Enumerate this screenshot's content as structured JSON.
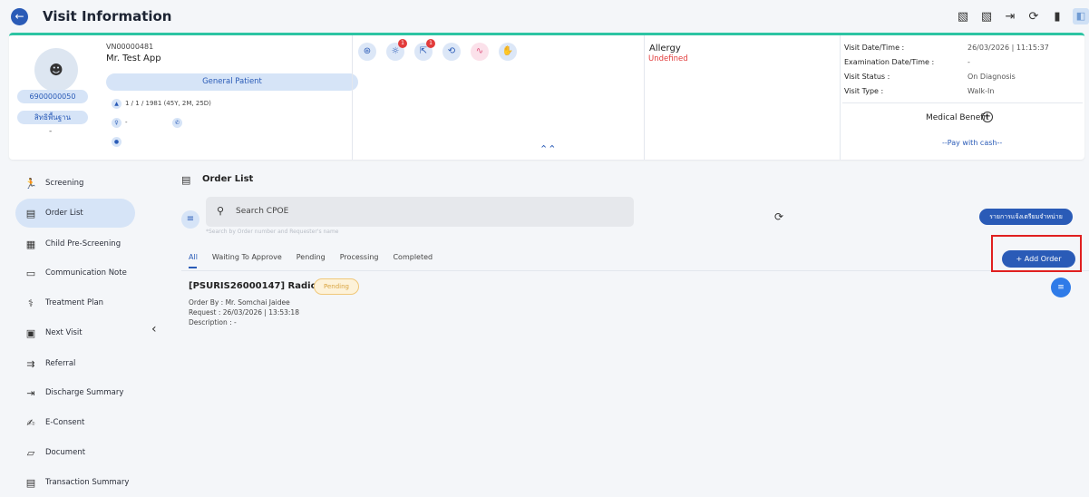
{
  "header": {
    "title": "Visit Information",
    "back_icon": "arrow-left-icon",
    "actions": [
      "print-icon",
      "print-alt-icon",
      "exit-icon",
      "refresh-icon",
      "delete-icon",
      "sidebar-toggle-icon"
    ]
  },
  "patient": {
    "vn": "VN00000481",
    "name": "Mr. Test App",
    "hn": "6900000050",
    "right": "สิทธิพื้นฐาน",
    "right_sub": "-",
    "patient_type": "General Patient",
    "dob": "1 / 1 / 1981 (45Y, 2M, 25D)",
    "contact": "-",
    "extra": ""
  },
  "quick_icons": [
    {
      "name": "vitals-icon",
      "glyph": "⊛"
    },
    {
      "name": "bug-icon",
      "glyph": "☼",
      "badge": "1"
    },
    {
      "name": "export-icon",
      "glyph": "⇱",
      "badge": "1"
    },
    {
      "name": "history-icon",
      "glyph": "⟲"
    },
    {
      "name": "trend-icon",
      "glyph": "〰"
    },
    {
      "name": "hand-icon",
      "glyph": "✋"
    }
  ],
  "allergy": {
    "title": "Allergy",
    "value": "Undefined"
  },
  "visit": {
    "datetime_label": "Visit Date/Time :",
    "datetime_value": "26/03/2026 | 11:15:37",
    "exam_label": "Examination Date/Time :",
    "exam_value": "-",
    "status_label": "Visit Status :",
    "status_value": "On Diagnosis",
    "type_label": "Visit Type :",
    "type_value": "Walk-In",
    "medical_benefit": "Medical Benefit",
    "pay": "--Pay with cash--"
  },
  "sidebar": {
    "items": [
      {
        "label": "Screening",
        "icon": "screening-icon",
        "glyph": "🏃"
      },
      {
        "label": "Order List",
        "icon": "order-list-icon",
        "glyph": "▤",
        "active": true
      },
      {
        "label": "Child Pre-Screening",
        "icon": "child-screening-icon",
        "glyph": "▦"
      },
      {
        "label": "Communication Note",
        "icon": "note-icon",
        "glyph": "▭"
      },
      {
        "label": "Treatment Plan",
        "icon": "treatment-icon",
        "glyph": "⚕"
      },
      {
        "label": "Next Visit",
        "icon": "calendar-icon",
        "glyph": "▣"
      },
      {
        "label": "Referral",
        "icon": "referral-icon",
        "glyph": "⇉"
      },
      {
        "label": "Discharge Summary",
        "icon": "discharge-icon",
        "glyph": "⇥"
      },
      {
        "label": "E-Consent",
        "icon": "consent-icon",
        "glyph": "✍"
      },
      {
        "label": "Document",
        "icon": "folder-icon",
        "glyph": "▱"
      },
      {
        "label": "Transaction Summary",
        "icon": "receipt-icon",
        "glyph": "▤"
      }
    ]
  },
  "main": {
    "title": "Order List",
    "search_placeholder": "Search CPOE",
    "search_hint": "*Search by Order number and Requester's name",
    "thai_button": "รายการแจ้งเตรียมจำหน่าย",
    "add_order": "+ Add Order",
    "tabs": [
      "All",
      "Waiting To Approve",
      "Pending",
      "Processing",
      "Completed"
    ],
    "order": {
      "title": "[PSURIS26000147] Radiology",
      "status": "Pending",
      "order_by": "Order By : Mr. Somchai Jaidee",
      "request": "Request : 26/03/2026 | 13:53:18",
      "description": "Description : -"
    }
  },
  "colors": {
    "primary": "#2a5bb7",
    "accent": "#2cc4a3",
    "danger": "#e23b3b",
    "pending": "#d9a441"
  }
}
